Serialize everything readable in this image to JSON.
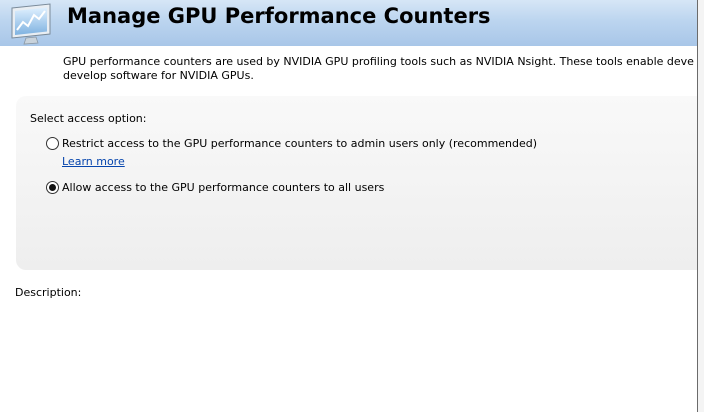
{
  "header": {
    "title": "Manage GPU Performance Counters",
    "icon": "monitor-chart-icon"
  },
  "intro": {
    "line1": "GPU performance counters are used by NVIDIA GPU profiling tools such as NVIDIA Nsight. These tools enable developers to debug, p",
    "line2": "develop software for NVIDIA GPUs."
  },
  "access": {
    "select_label": "Select access option:",
    "options": [
      {
        "label": "Restrict access to the GPU performance counters to admin users only (recommended)",
        "checked": false
      },
      {
        "label": "Allow access to the GPU performance counters to all users",
        "checked": true
      }
    ],
    "learn_more": "Learn more"
  },
  "description": {
    "label": "Description:"
  },
  "colors": {
    "header_gradient_top": "#d6e6f6",
    "header_gradient_bottom": "#a8c6e8",
    "link": "#0645ad",
    "panel": "#f1f1f1"
  }
}
